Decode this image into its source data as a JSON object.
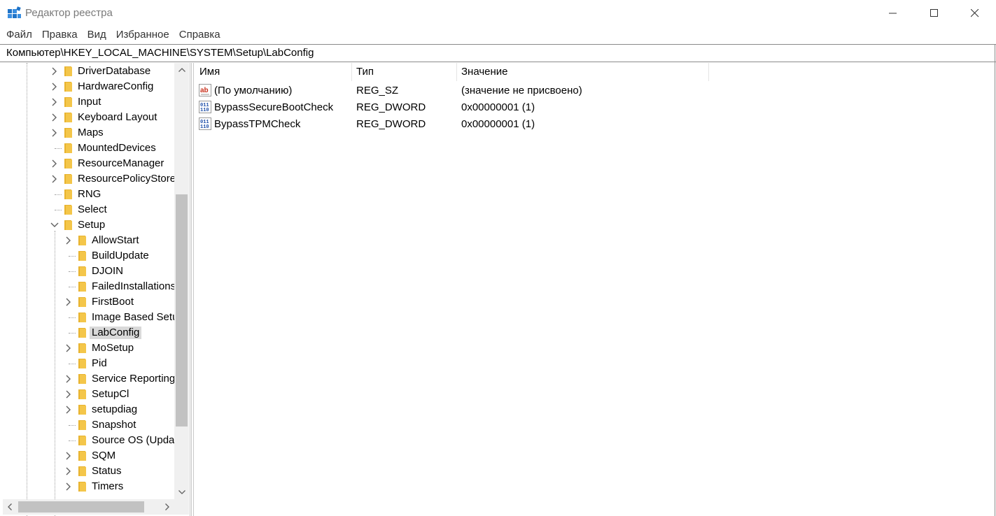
{
  "window": {
    "title": "Редактор реестра",
    "minimize_label": "Minimize",
    "maximize_label": "Maximize",
    "close_label": "Close"
  },
  "menu": {
    "items": [
      {
        "label": "Файл"
      },
      {
        "label": "Правка"
      },
      {
        "label": "Вид"
      },
      {
        "label": "Избранное"
      },
      {
        "label": "Справка"
      }
    ]
  },
  "address": {
    "path": "Компьютер\\HKEY_LOCAL_MACHINE\\SYSTEM\\Setup\\LabConfig"
  },
  "tree": {
    "items": [
      {
        "label": "DriverDatabase",
        "level": 1,
        "expander": "collapsed"
      },
      {
        "label": "HardwareConfig",
        "level": 1,
        "expander": "collapsed"
      },
      {
        "label": "Input",
        "level": 1,
        "expander": "collapsed"
      },
      {
        "label": "Keyboard Layout",
        "level": 1,
        "expander": "collapsed"
      },
      {
        "label": "Maps",
        "level": 1,
        "expander": "collapsed"
      },
      {
        "label": "MountedDevices",
        "level": 1,
        "expander": "none"
      },
      {
        "label": "ResourceManager",
        "level": 1,
        "expander": "collapsed"
      },
      {
        "label": "ResourcePolicyStore",
        "level": 1,
        "expander": "collapsed"
      },
      {
        "label": "RNG",
        "level": 1,
        "expander": "none"
      },
      {
        "label": "Select",
        "level": 1,
        "expander": "none"
      },
      {
        "label": "Setup",
        "level": 1,
        "expander": "expanded"
      },
      {
        "label": "AllowStart",
        "level": 2,
        "expander": "collapsed"
      },
      {
        "label": "BuildUpdate",
        "level": 2,
        "expander": "none"
      },
      {
        "label": "DJOIN",
        "level": 2,
        "expander": "none"
      },
      {
        "label": "FailedInstallations",
        "level": 2,
        "expander": "none"
      },
      {
        "label": "FirstBoot",
        "level": 2,
        "expander": "collapsed"
      },
      {
        "label": "Image Based Setu",
        "level": 2,
        "expander": "none"
      },
      {
        "label": "LabConfig",
        "level": 2,
        "expander": "none",
        "selected": true
      },
      {
        "label": "MoSetup",
        "level": 2,
        "expander": "collapsed"
      },
      {
        "label": "Pid",
        "level": 2,
        "expander": "none"
      },
      {
        "label": "Service Reporting",
        "level": 2,
        "expander": "collapsed"
      },
      {
        "label": "SetupCl",
        "level": 2,
        "expander": "collapsed"
      },
      {
        "label": "setupdiag",
        "level": 2,
        "expander": "collapsed"
      },
      {
        "label": "Snapshot",
        "level": 2,
        "expander": "none"
      },
      {
        "label": "Source OS (Updat",
        "level": 2,
        "expander": "none"
      },
      {
        "label": "SQM",
        "level": 2,
        "expander": "collapsed"
      },
      {
        "label": "Status",
        "level": 2,
        "expander": "collapsed"
      },
      {
        "label": "Timers",
        "level": 2,
        "expander": "collapsed"
      }
    ]
  },
  "list": {
    "columns": {
      "name": "Имя",
      "type": "Тип",
      "value": "Значение"
    },
    "rows": [
      {
        "name": "(По умолчанию)",
        "type": "REG_SZ",
        "value": "(значение не присвоено)",
        "icon": "string-value-icon"
      },
      {
        "name": "BypassSecureBootCheck",
        "type": "REG_DWORD",
        "value": "0x00000001 (1)",
        "icon": "binary-value-icon"
      },
      {
        "name": "BypassTPMCheck",
        "type": "REG_DWORD",
        "value": "0x00000001 (1)",
        "icon": "binary-value-icon"
      }
    ]
  },
  "colors": {
    "folder": "#f4c64a",
    "selection": "#d9d9d9",
    "scrollbar_track": "#f0f0f0",
    "scrollbar_thumb": "#c2c2c2"
  }
}
